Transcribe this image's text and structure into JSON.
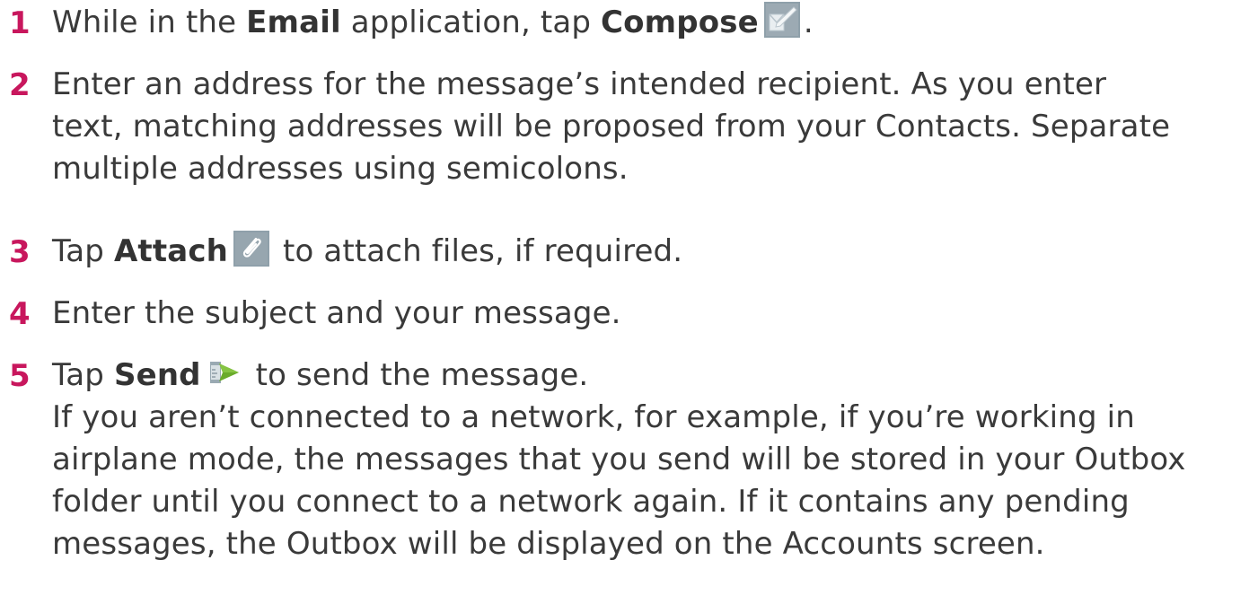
{
  "steps": [
    {
      "num": "1",
      "pre": "While in the ",
      "bold1": "Email",
      "mid": " application, tap ",
      "bold2": "Compose",
      "post": ".",
      "icon": "compose-icon"
    },
    {
      "num": "2",
      "lines": [
        "Enter an address for the message’s intended recipient. As you enter",
        "text, matching addresses will be proposed from your Contacts. Separate",
        "multiple addresses using semicolons."
      ]
    },
    {
      "num": "3",
      "pre": "Tap ",
      "bold": "Attach",
      "post": " to attach files, if required.",
      "icon": "attach-icon"
    },
    {
      "num": "4",
      "text": "Enter the subject and your message."
    },
    {
      "num": "5",
      "pre": "Tap ",
      "bold": "Send",
      "post": " to send the message.",
      "icon": "send-icon",
      "note_lines": [
        "If you aren’t connected to a network, for example, if you’re working in",
        "airplane mode, the messages that you send will be stored in your Outbox",
        "folder until you connect to a network again. If it contains any pending",
        "messages, the Outbox will be displayed on the Accounts screen."
      ]
    }
  ],
  "colors": {
    "step_number": "#c8175d",
    "body_text": "#3a3a3a",
    "icon_bg": "#8a9aa3"
  }
}
